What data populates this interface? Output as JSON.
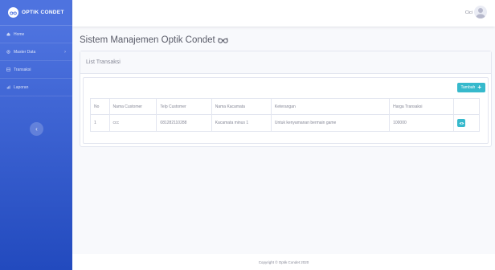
{
  "brand": {
    "name": "OPTIK CONDET"
  },
  "sidebar": {
    "items": [
      {
        "label": "Home",
        "icon": "home-icon"
      },
      {
        "label": "Master Data",
        "icon": "cog-icon",
        "chevron": "›"
      },
      {
        "label": "Transaksi",
        "icon": "table-icon"
      },
      {
        "label": "Laporan",
        "icon": "report-icon"
      }
    ],
    "toggle": "‹"
  },
  "topbar": {
    "user_name": "Cici"
  },
  "page": {
    "title": "Sistem Manajemen Optik Condet"
  },
  "card": {
    "header": "List Transaksi",
    "add_button": "Tambah",
    "add_icon": "+"
  },
  "table": {
    "headers": [
      "No",
      "Nama Customer",
      "Telp Customer",
      "Nama Kacamata",
      "Keterangan",
      "Harga Transaksi",
      ""
    ],
    "rows": [
      {
        "no": "1",
        "customer": "ccc",
        "phone": "081282110288",
        "glasses": "Kacamata minus 1",
        "note": "Untuk kenyamanan bermain game",
        "price": "100000"
      }
    ]
  },
  "footer": {
    "text": "Copyright © Optik Condet 2020"
  },
  "colors": {
    "primary": "#4e73df",
    "info": "#36b9cc",
    "text_muted": "#858796"
  }
}
